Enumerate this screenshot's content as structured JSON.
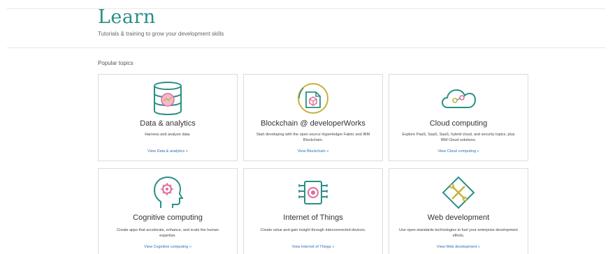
{
  "header": {
    "title": "Learn",
    "subtitle": "Tutorials & training to grow your development skills"
  },
  "section": {
    "label": "Popular topics"
  },
  "cards": [
    {
      "title": "Data & analytics",
      "description": "Harness and analyze data.",
      "link": "View Data & analytics »",
      "icon": "database-icon"
    },
    {
      "title": "Blockchain @ developerWorks",
      "description": "Start developing with the open source Hyperledger Fabric and IBM Blockchain.",
      "link": "View Blockchain »",
      "icon": "blockchain-icon"
    },
    {
      "title": "Cloud computing",
      "description": "Explore PaaS, SaaS, SaaS, hybrid cloud, and security topics, plus IBM Cloud solutions.",
      "link": "View Cloud computing »",
      "icon": "cloud-icon"
    },
    {
      "title": "Cognitive computing",
      "description": "Create apps that accelerate, enhance, and scale the human expertise.",
      "link": "View Cognitive computing »",
      "icon": "head-gear-icon"
    },
    {
      "title": "Internet of Things",
      "description": "Create value and gain insight through interconnected devices.",
      "link": "View Internet of Things »",
      "icon": "chip-icon"
    },
    {
      "title": "Web development",
      "description": "Use open-standards technologies to fuel your enterprise development efforts.",
      "link": "View Web development »",
      "icon": "web-tools-icon"
    }
  ],
  "colors": {
    "teal": "#2a8f86",
    "pink": "#e06b9a",
    "olive": "#c7b23a",
    "link": "#2c6fb3"
  }
}
